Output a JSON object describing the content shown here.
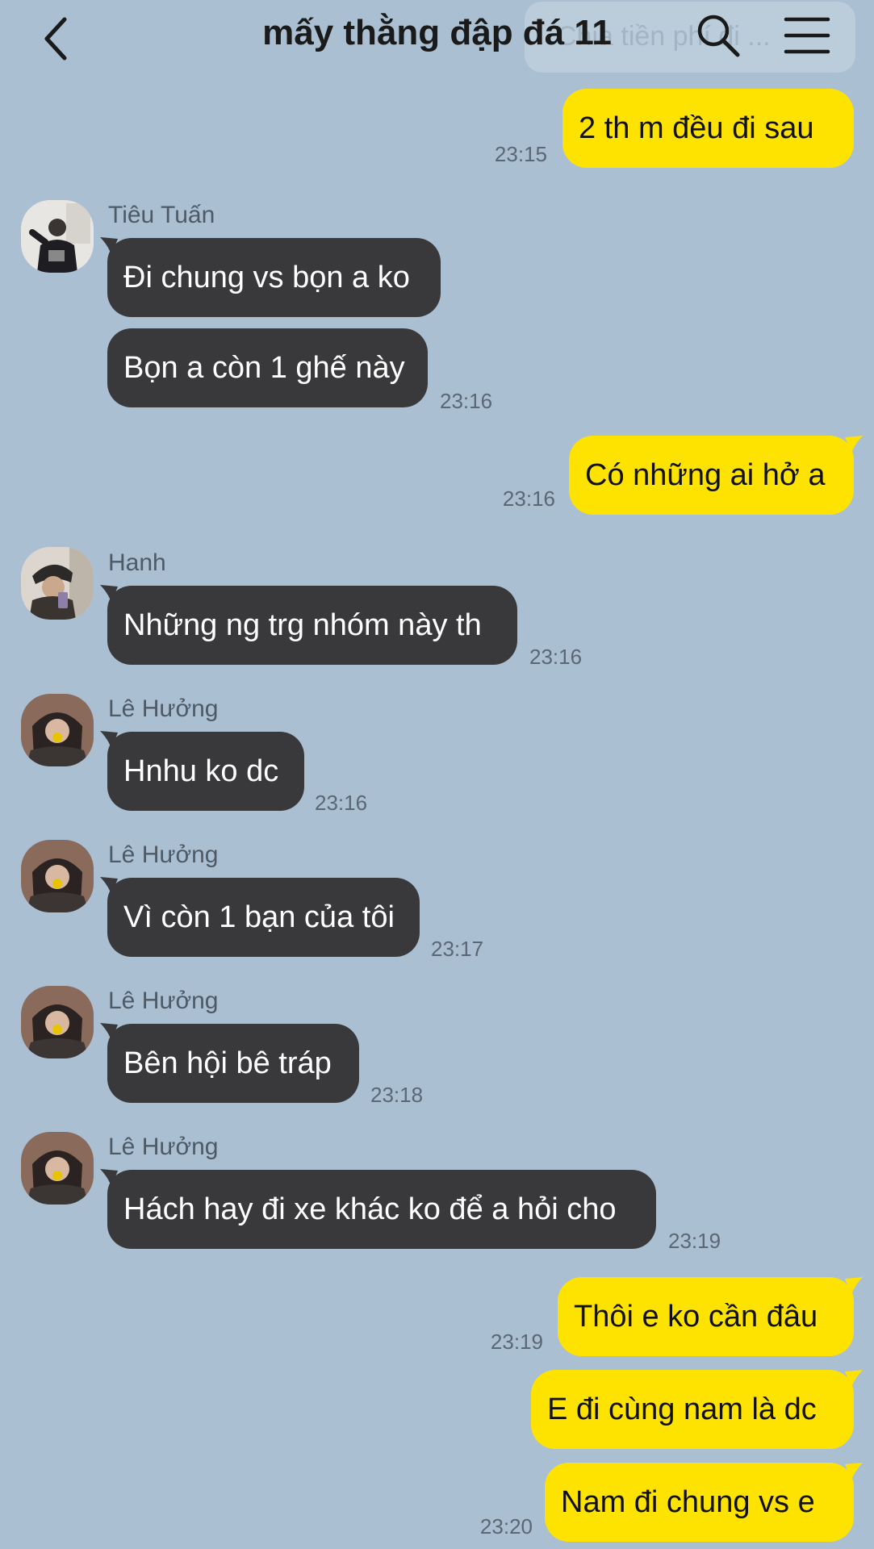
{
  "header": {
    "title": "mấy thằng đập đá 11",
    "ghost_text": "Chia tiền phí đi ..."
  },
  "messages": [
    {
      "direction": "out",
      "text": "2 th m đều đi sau",
      "time": "23:15"
    },
    {
      "direction": "in",
      "sender": "Tiêu Tuấn",
      "text": "Đi chung vs bọn a ko"
    },
    {
      "direction": "in",
      "text": "Bọn a còn 1 ghế này",
      "time": "23:16"
    },
    {
      "direction": "out",
      "text": "Có những ai hở a",
      "time": "23:16"
    },
    {
      "direction": "in",
      "sender": "Hanh",
      "text": "Những ng trg nhóm này th",
      "time": "23:16"
    },
    {
      "direction": "in",
      "sender": "Lê Hưởng",
      "text": "Hnhu ko dc",
      "time": "23:16"
    },
    {
      "direction": "in",
      "sender": "Lê Hưởng",
      "text": "Vì còn 1 bạn của tôi",
      "time": "23:17"
    },
    {
      "direction": "in",
      "sender": "Lê Hưởng",
      "text": "Bên hội bê tráp",
      "time": "23:18"
    },
    {
      "direction": "in",
      "sender": "Lê Hưởng",
      "text": "Hách hay đi xe khác ko để a hỏi cho",
      "time": "23:19"
    },
    {
      "direction": "out",
      "text": "Thôi e ko cần đâu",
      "time": "23:19"
    },
    {
      "direction": "out",
      "text": "E đi cùng nam là dc"
    },
    {
      "direction": "out",
      "text": "Nam đi chung vs e",
      "time": "23:20"
    }
  ],
  "colors": {
    "background": "#aabfd2",
    "incoming_bubble": "#39393b",
    "outgoing_bubble": "#ffe300"
  },
  "icons": {
    "back": "chevron-left-icon",
    "search": "search-icon",
    "menu": "hamburger-menu-icon"
  }
}
